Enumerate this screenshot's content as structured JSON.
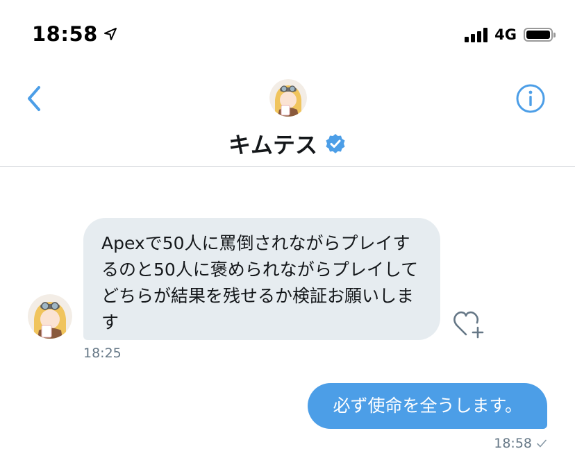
{
  "status_bar": {
    "time": "18:58",
    "network": "4G",
    "icons": [
      "location-arrow-icon",
      "signal-bars-icon",
      "battery-icon"
    ]
  },
  "header": {
    "name": "キムテス",
    "verified": true,
    "icons": [
      "back-chevron-icon",
      "info-icon",
      "verified-badge-icon"
    ]
  },
  "messages": [
    {
      "direction": "received",
      "text": "Apexで50人に罵倒されながらプレイするのと50人に褒められながらプレイしてどちらが結果を残せるか検証お願いします",
      "time": "18:25"
    },
    {
      "direction": "sent",
      "text": "必ず使命を全うします。",
      "time": "18:58",
      "status_icon": "sent-check-icon"
    }
  ],
  "colors": {
    "accent": "#4c9ee7",
    "received_bubble": "#e6ecf0",
    "meta_text": "#657786",
    "verified": "#4c9ee7"
  }
}
